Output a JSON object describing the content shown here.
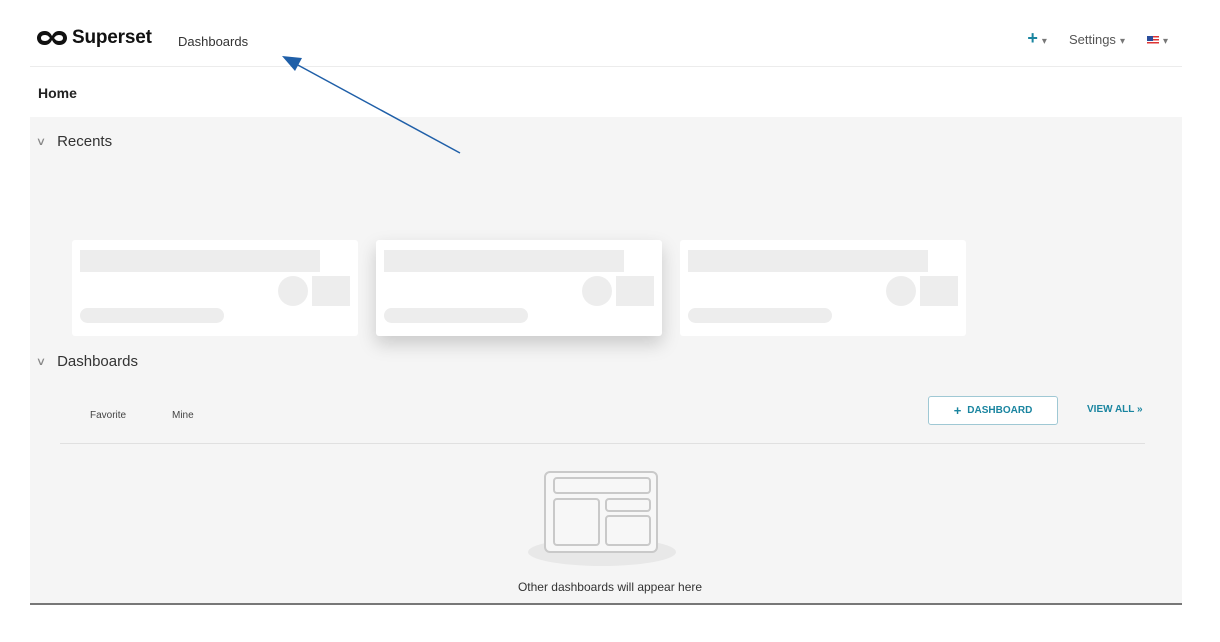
{
  "header": {
    "app_name": "Superset",
    "nav_dashboards": "Dashboards",
    "add_label": "+",
    "settings_label": "Settings",
    "caret": "▾"
  },
  "page": {
    "title": "Home"
  },
  "recents": {
    "title": "Recents"
  },
  "dashboards": {
    "title": "Dashboards",
    "tabs": [
      "Favorite",
      "Mine"
    ],
    "add_button_icon": "+",
    "add_button_label": "DASHBOARD",
    "view_all_label": "VIEW ALL »",
    "empty_text": "Other dashboards will appear here"
  },
  "icons": {
    "logo": "superset-infinity-logo",
    "flag": "us-flag-icon",
    "chevron": "chevron-down-icon",
    "empty": "empty-dashboard-icon"
  },
  "colors": {
    "accent": "#1a85a0",
    "annotation_arrow": "#1f5fa8",
    "content_bg": "#f5f5f5"
  }
}
